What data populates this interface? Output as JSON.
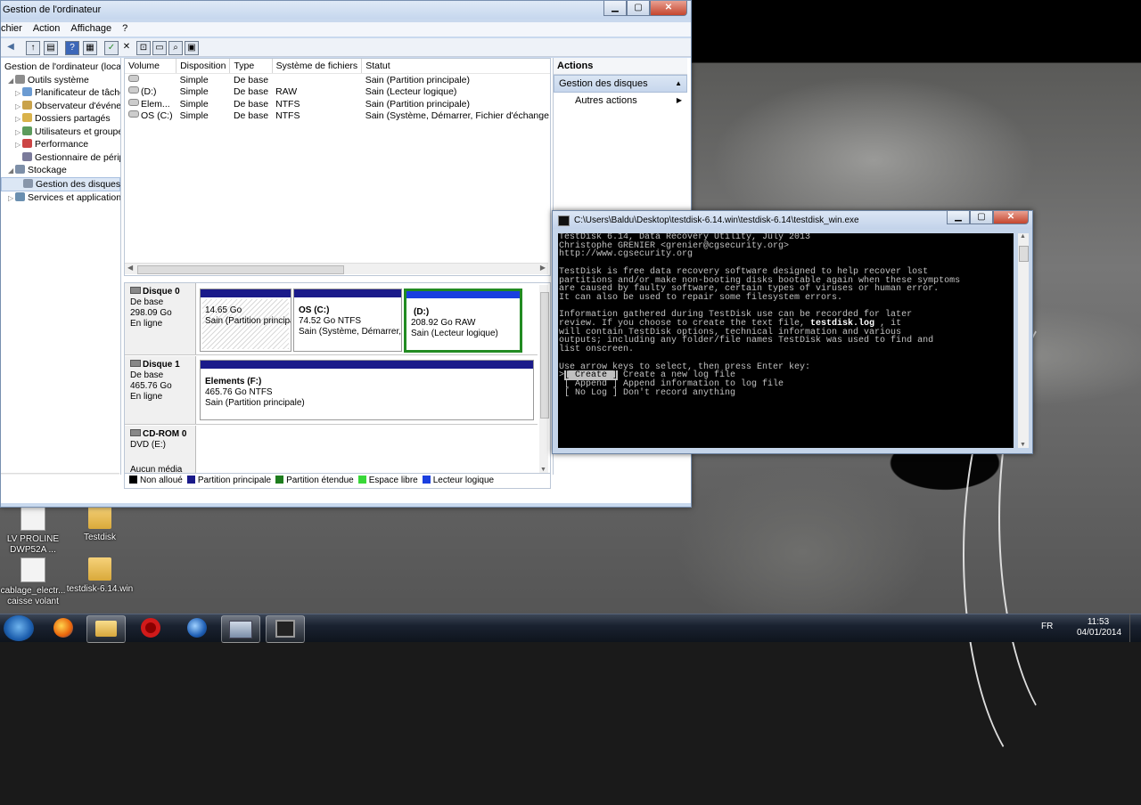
{
  "mmc": {
    "title": "Gestion de l'ordinateur",
    "menu": [
      "chier",
      "Action",
      "Affichage",
      "?"
    ],
    "tree": [
      {
        "label": "Gestion de l'ordinateur (local)",
        "indent": 0,
        "expander": "",
        "icon": "computer-icon"
      },
      {
        "label": "Outils système",
        "indent": 1,
        "expander": "◢",
        "icon": "tools-icon"
      },
      {
        "label": "Planificateur de tâches",
        "indent": 2,
        "expander": "▷",
        "icon": "clock-icon"
      },
      {
        "label": "Observateur d'événeme",
        "indent": 2,
        "expander": "▷",
        "icon": "event-viewer-icon"
      },
      {
        "label": "Dossiers partagés",
        "indent": 2,
        "expander": "▷",
        "icon": "shared-folder-icon"
      },
      {
        "label": "Utilisateurs et groupes l",
        "indent": 2,
        "expander": "▷",
        "icon": "users-icon"
      },
      {
        "label": "Performance",
        "indent": 2,
        "expander": "▷",
        "icon": "performance-icon"
      },
      {
        "label": "Gestionnaire de périphé",
        "indent": 2,
        "expander": "",
        "icon": "device-manager-icon"
      },
      {
        "label": "Stockage",
        "indent": 1,
        "expander": "◢",
        "icon": "storage-icon"
      },
      {
        "label": "Gestion des disques",
        "indent": 2,
        "expander": "",
        "icon": "disk-management-icon",
        "selected": true
      },
      {
        "label": "Services et applications",
        "indent": 1,
        "expander": "▷",
        "icon": "services-icon"
      }
    ],
    "volumes": {
      "headers": [
        "Volume",
        "Disposition",
        "Type",
        "Système de fichiers",
        "Statut"
      ],
      "rows": [
        [
          "",
          "Simple",
          "De base",
          "",
          "Sain (Partition principale)"
        ],
        [
          "(D:)",
          "Simple",
          "De base",
          "RAW",
          "Sain (Lecteur logique)"
        ],
        [
          "Elem...",
          "Simple",
          "De base",
          "NTFS",
          "Sain (Partition principale)"
        ],
        [
          "OS (C:)",
          "Simple",
          "De base",
          "NTFS",
          "Sain (Système, Démarrer, Fichier d'échange, Actif, Vidage sur incident, Partition principale)"
        ]
      ]
    },
    "disks": {
      "disk0": {
        "name": "Disque 0",
        "type": "De base",
        "size": "298.09 Go",
        "state": "En ligne",
        "p1": {
          "l1": "14.65 Go",
          "l2": "Sain (Partition principale)"
        },
        "p2": {
          "title": "OS  (C:)",
          "l1": "74.52 Go NTFS",
          "l2": "Sain (Système, Démarrer, Fichier d'échange)"
        },
        "p3": {
          "title": "(D:)",
          "l1": "208.92 Go RAW",
          "l2": "Sain (Lecteur logique)"
        }
      },
      "disk1": {
        "name": "Disque 1",
        "type": "De base",
        "size": "465.76 Go",
        "state": "En ligne",
        "p1": {
          "title": "Elements  (F:)",
          "l1": "465.76 Go NTFS",
          "l2": "Sain (Partition principale)"
        }
      },
      "cdrom": {
        "name": "CD-ROM 0",
        "type": "DVD (E:)",
        "state": "Aucun média"
      }
    },
    "legend": [
      {
        "label": "Non alloué",
        "color": "#000000"
      },
      {
        "label": "Partition principale",
        "color": "#1a1a8a"
      },
      {
        "label": "Partition étendue",
        "color": "#1e7d1e"
      },
      {
        "label": "Espace libre",
        "color": "#38d838"
      },
      {
        "label": "Lecteur logique",
        "color": "#1a3fe0"
      }
    ],
    "actions": {
      "header": "Actions",
      "section": "Gestion des disques",
      "more": "Autres actions"
    }
  },
  "console": {
    "title": "C:\\Users\\Baldu\\Desktop\\testdisk-6.14.win\\testdisk-6.14\\testdisk_win.exe",
    "lines": [
      "TestDisk 6.14, Data Recovery Utility, July 2013",
      "Christophe GRENIER <grenier@cgsecurity.org>",
      "http://www.cgsecurity.org",
      "",
      "TestDisk is free data recovery software designed to help recover lost",
      "partitions and/or make non-booting disks bootable again when these symptoms",
      "are caused by faulty software, certain types of viruses or human error.",
      "It can also be used to repair some filesystem errors.",
      "",
      "Information gathered during TestDisk use can be recorded for later",
      "review. If you choose to create the text file, ",
      "will contain TestDisk options, technical information and various",
      "outputs; including any folder/file names TestDisk was used to find and",
      "list onscreen.",
      "",
      "Use arrow keys to select, then press Enter key:"
    ],
    "logfile": "testdisk.log",
    "logfile_suffix": " , it",
    "options": [
      {
        "key": "[ Create ]",
        "desc": " Create a new log file",
        "prefix": ">"
      },
      {
        "key": "[ Append ]",
        "desc": " Append information to log file",
        "prefix": " "
      },
      {
        "key": "[ No Log ]",
        "desc": " Don't record anything",
        "prefix": " "
      }
    ]
  },
  "desktop_icons": [
    {
      "label": "LV PROLINE DWP52A ...",
      "icon": "document-icon"
    },
    {
      "label": "Testdisk",
      "icon": "folder-icon"
    },
    {
      "label": "cablage_electr... caisse volant",
      "icon": "image-file-icon"
    },
    {
      "label": "testdisk-6.14.win",
      "icon": "folder-icon"
    }
  ],
  "taskbar": {
    "apps": [
      "windows-start-icon",
      "firefox-icon",
      "explorer-icon",
      "opera-icon",
      "google-earth-icon",
      "computer-management-icon",
      "testdisk-icon"
    ],
    "lang": "FR",
    "time": "11:53",
    "date": "04/01/2014"
  }
}
